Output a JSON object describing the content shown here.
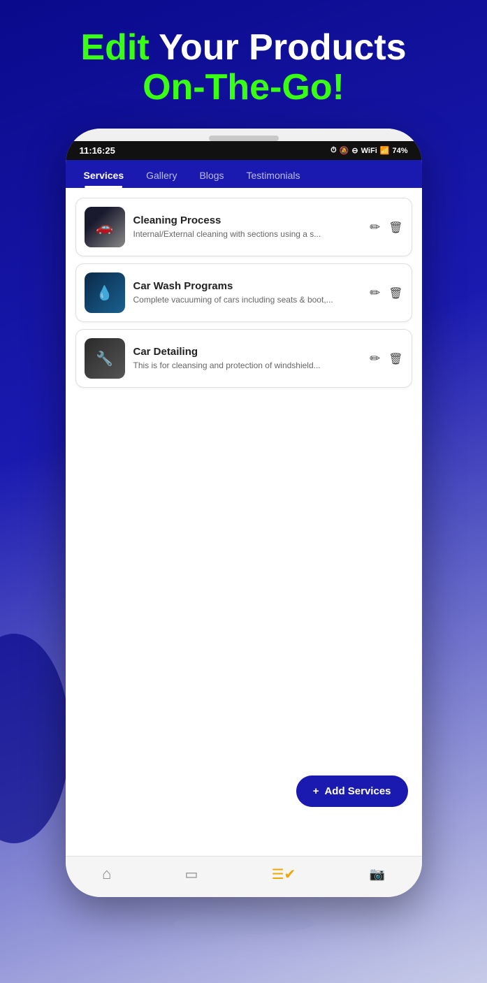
{
  "page": {
    "header": {
      "line1_edit": "Edit",
      "line1_rest": " Your Products",
      "line2": "On-The-Go!"
    },
    "status_bar": {
      "time": "11:16:25",
      "battery": "74%"
    },
    "nav_tabs": [
      {
        "label": "Services",
        "active": true
      },
      {
        "label": "Gallery",
        "active": false
      },
      {
        "label": "Blogs",
        "active": false
      },
      {
        "label": "Testimonials",
        "active": false
      }
    ],
    "services": [
      {
        "id": 1,
        "title": "Cleaning Process",
        "description": "Internal/External cleaning with sections using a s..."
      },
      {
        "id": 2,
        "title": "Car Wash Programs",
        "description": "Complete vacuuming of cars including seats & boot,..."
      },
      {
        "id": 3,
        "title": "Car Detailing",
        "description": "This is for cleansing and protection of windshield..."
      }
    ],
    "add_button": {
      "label": "Add Services",
      "icon": "+"
    },
    "bottom_nav": [
      {
        "label": "Home",
        "icon": "home",
        "active": false
      },
      {
        "label": "Shop",
        "icon": "shop",
        "active": false
      },
      {
        "label": "List",
        "icon": "list",
        "active": true
      },
      {
        "label": "Video",
        "icon": "video",
        "active": false
      }
    ]
  },
  "colors": {
    "accent_green": "#39ff14",
    "nav_bg": "#1a1ab0",
    "add_btn_bg": "#1a1ab0"
  }
}
